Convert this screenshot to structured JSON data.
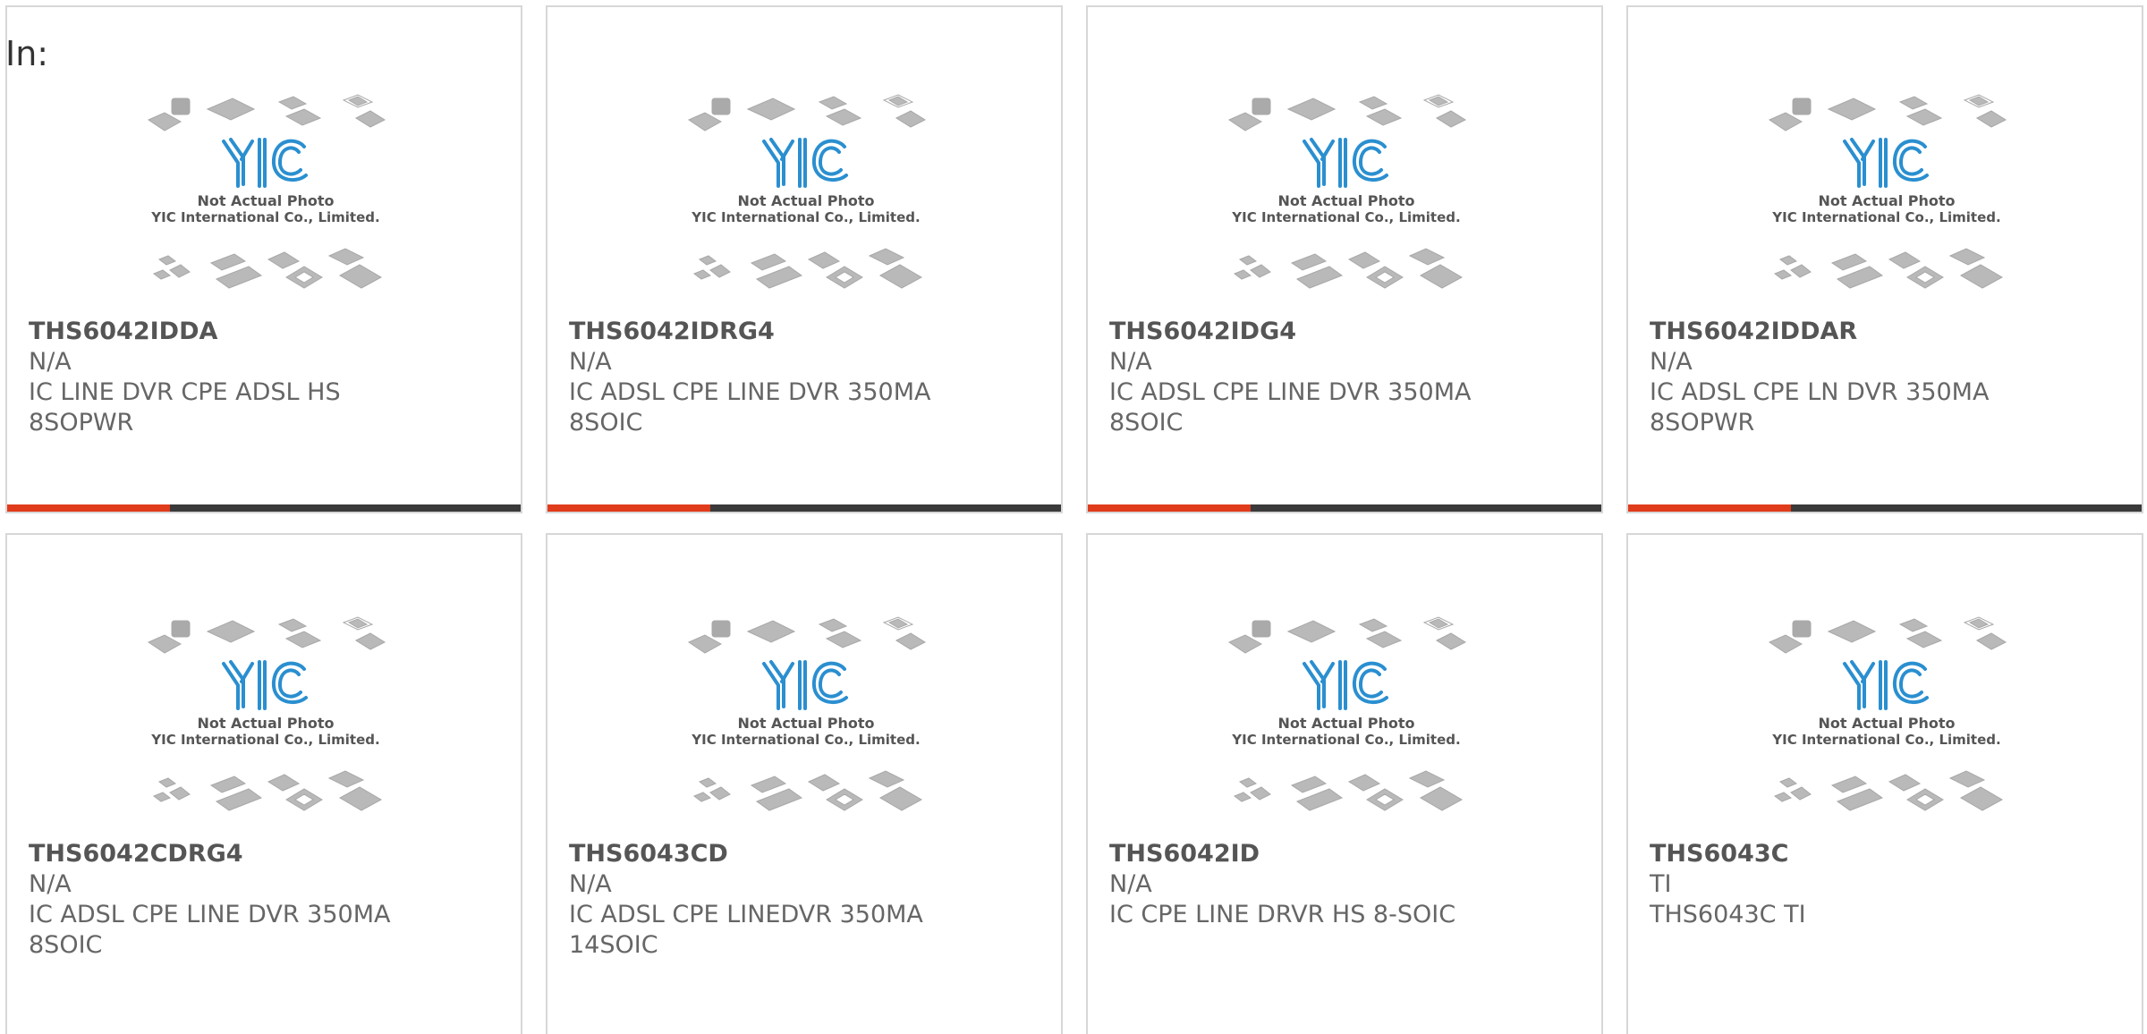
{
  "header": {
    "label": "In:"
  },
  "photo": {
    "caption_line1": "Not Actual Photo",
    "caption_line2": "YIC International Co., Limited.",
    "logo_text": "YIC"
  },
  "products": [
    {
      "part": "THS6042IDDA",
      "mfr": "N/A",
      "desc1": "IC LINE DVR CPE ADSL HS",
      "desc2": "8SOPWR",
      "has_bar": true
    },
    {
      "part": "THS6042IDRG4",
      "mfr": "N/A",
      "desc1": "IC ADSL CPE LINE DVR 350MA",
      "desc2": "8SOIC",
      "has_bar": true
    },
    {
      "part": "THS6042IDG4",
      "mfr": "N/A",
      "desc1": "IC ADSL CPE LINE DVR 350MA",
      "desc2": "8SOIC",
      "has_bar": true
    },
    {
      "part": "THS6042IDDAR",
      "mfr": "N/A",
      "desc1": "IC ADSL CPE LN DVR 350MA",
      "desc2": "8SOPWR",
      "has_bar": true
    },
    {
      "part": "THS6042CDRG4",
      "mfr": "N/A",
      "desc1": "IC ADSL CPE LINE DVR 350MA",
      "desc2": "8SOIC",
      "has_bar": false
    },
    {
      "part": "THS6043CD",
      "mfr": "N/A",
      "desc1": "IC ADSL CPE LINEDVR 350MA",
      "desc2": "14SOIC",
      "has_bar": false
    },
    {
      "part": "THS6042ID",
      "mfr": "N/A",
      "desc1": "IC CPE LINE DRVR HS 8-SOIC",
      "desc2": "",
      "has_bar": false
    },
    {
      "part": "THS6043C",
      "mfr": "TI",
      "desc1": "THS6043C TI",
      "desc2": "",
      "has_bar": false
    }
  ],
  "colors": {
    "accent": "#e03c1c",
    "bar": "#3a3a3a",
    "logo_blue": "#2a8fd0",
    "chip_gray": "#b9b9b9"
  }
}
